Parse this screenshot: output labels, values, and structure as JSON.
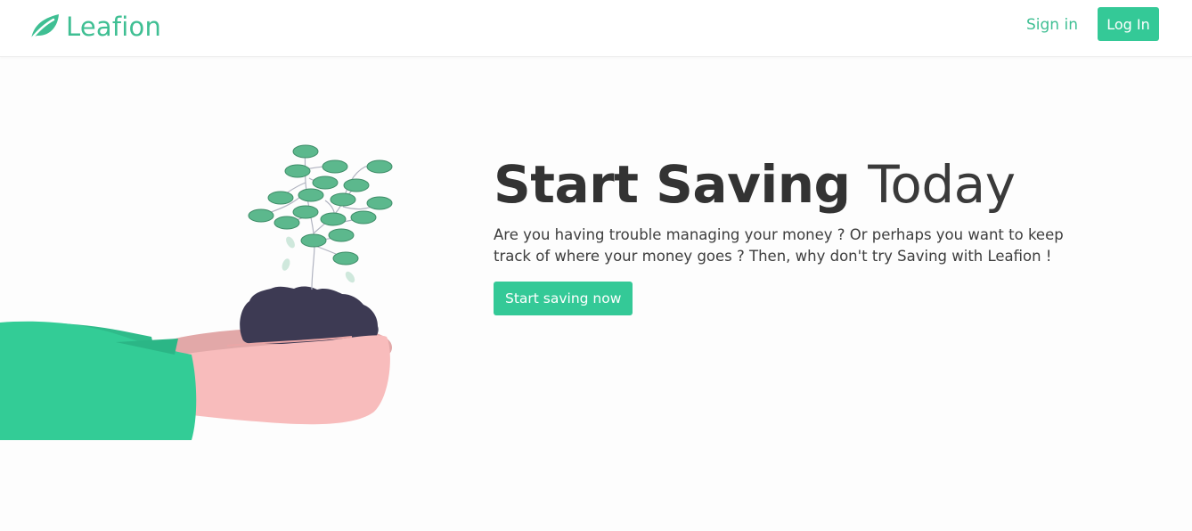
{
  "navbar": {
    "brand_name": "Leafion",
    "brand_icon": "leaf-icon",
    "signin_label": "Sign in",
    "login_label": "Log In"
  },
  "hero": {
    "title_bold": "Start Saving",
    "title_light": "Today",
    "subtitle": "Are you having trouble managing your money ? Or perhaps you want to keep track of where your money goes ? Then, why don't try Saving with Leafion !",
    "cta_label": "Start saving now",
    "illustration": "hands-holding-money-plant-illustration"
  },
  "colors": {
    "brand": "#3fbf93",
    "button": "#34c997",
    "sleeve": "#33cc96",
    "skin": "#f8bcbc",
    "soil": "#3d3a53",
    "coin": "#5cb88d"
  }
}
